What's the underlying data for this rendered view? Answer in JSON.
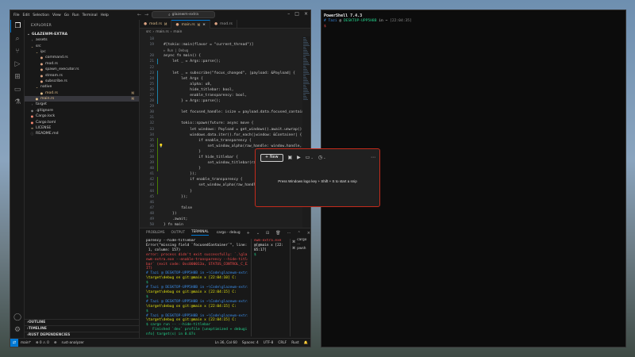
{
  "vscode": {
    "menu": [
      "File",
      "Edit",
      "Selection",
      "View",
      "Go",
      "Run",
      "Terminal",
      "Help"
    ],
    "search": "glazewm-extra",
    "explorer_header": "EXPLORER",
    "project_root": "GLAZEWM-EXTRA",
    "tree": [
      {
        "label": "assets",
        "indent": 1,
        "icon": "›",
        "color": "c-gray",
        "badge": ""
      },
      {
        "label": "src",
        "indent": 1,
        "icon": "⌄",
        "color": "c-yellow",
        "badge": ""
      },
      {
        "label": "ipc",
        "indent": 2,
        "icon": "⌄",
        "color": "c-yellow",
        "badge": ""
      },
      {
        "label": "command.rs",
        "indent": 3,
        "icon": "●",
        "color": "c-rust",
        "badge": ""
      },
      {
        "label": "mod.rs",
        "indent": 3,
        "icon": "●",
        "color": "c-rust",
        "badge": ""
      },
      {
        "label": "spawn_executor.rs",
        "indent": 3,
        "icon": "●",
        "color": "c-rust",
        "badge": ""
      },
      {
        "label": "stream.rs",
        "indent": 3,
        "icon": "●",
        "color": "c-rust",
        "badge": ""
      },
      {
        "label": "subscribe.rs",
        "indent": 3,
        "icon": "●",
        "color": "c-rust",
        "badge": ""
      },
      {
        "label": "native",
        "indent": 2,
        "icon": "⌄",
        "color": "c-yellow",
        "badge": ""
      },
      {
        "label": "mod.rs",
        "indent": 3,
        "icon": "●",
        "color": "c-yellow",
        "badge": "M"
      },
      {
        "label": "main.rs",
        "indent": 2,
        "icon": "●",
        "color": "c-yellow",
        "badge": "M",
        "selected": true
      },
      {
        "label": "target",
        "indent": 1,
        "icon": "›",
        "color": "c-gray",
        "badge": ""
      },
      {
        "label": ".gitignore",
        "indent": 1,
        "icon": "◆",
        "color": "c-gray",
        "badge": ""
      },
      {
        "label": "Cargo.lock",
        "indent": 1,
        "icon": "●",
        "color": "c-red",
        "badge": ""
      },
      {
        "label": "Cargo.toml",
        "indent": 1,
        "icon": "●",
        "color": "c-red",
        "badge": ""
      },
      {
        "label": "LICENSE",
        "indent": 1,
        "icon": "≡",
        "color": "c-yellow",
        "badge": ""
      },
      {
        "label": "README.md",
        "indent": 1,
        "icon": "ⓘ",
        "color": "c-gray",
        "badge": ""
      }
    ],
    "sections": [
      "OUTLINE",
      "TIMELINE",
      "RUST DEPENDENCIES"
    ],
    "tabs": [
      {
        "label": "mod.rs",
        "mod": "M",
        "active": false
      },
      {
        "label": "main.rs",
        "mod": "M",
        "active": true
      },
      {
        "label": "mod.rs",
        "mod": "",
        "active": false
      }
    ],
    "breadcrumb": [
      "src",
      "main.rs",
      "main"
    ],
    "code": [
      {
        "n": "18",
        "t": "",
        "g": "none"
      },
      {
        "n": "19",
        "t": "#[tokio::main(flavor = \"current_thread\")]",
        "g": "none"
      },
      {
        "n": "",
        "t": "▷ Run | Debug",
        "g": "none",
        "lens": true
      },
      {
        "n": "20",
        "t": "async fn main() {",
        "g": "none"
      },
      {
        "n": "21",
        "t": "    let _ = Args::parse();",
        "g": "mod"
      },
      {
        "n": "22",
        "t": "",
        "g": "none"
      },
      {
        "n": "23",
        "t": "    let _ = subscribe(\"focus_changed\", |payload: &Payload| {",
        "g": "mod"
      },
      {
        "n": "24",
        "t": "        let Args {",
        "g": "mod"
      },
      {
        "n": "25",
        "t": "            alpha: u8,",
        "g": "mod"
      },
      {
        "n": "26",
        "t": "            hide_titlebar: bool,",
        "g": "mod"
      },
      {
        "n": "27",
        "t": "            enable_transparency: bool,",
        "g": "mod"
      },
      {
        "n": "28",
        "t": "        } = Args::parse();",
        "g": "mod"
      },
      {
        "n": "29",
        "t": "",
        "g": "none"
      },
      {
        "n": "30",
        "t": "        let focused_handle: isize = payload.data.focused_container.h",
        "g": "none"
      },
      {
        "n": "31",
        "t": "",
        "g": "none"
      },
      {
        "n": "32",
        "t": "        tokio::spawn(future: async move {",
        "g": "none"
      },
      {
        "n": "33",
        "t": "            let windows: Payload = get_windows().await.unwrap();",
        "g": "none"
      },
      {
        "n": "34",
        "t": "            windows.data.iter().for_each(|window: &Container| {",
        "g": "none"
      },
      {
        "n": "35",
        "t": "                if enable_transparency {",
        "g": "add"
      },
      {
        "n": "36",
        "t": "                    set_window_alpha(raw_handle: window.handle, alpha",
        "g": "add",
        "bulb": true
      },
      {
        "n": "37",
        "t": "                }",
        "g": "add"
      },
      {
        "n": "38",
        "t": "                if hide_titlebar {",
        "g": "add"
      },
      {
        "n": "39",
        "t": "                    set_window_titlebar(raw_handl",
        "g": "add"
      },
      {
        "n": "40",
        "t": "                }",
        "g": "add"
      },
      {
        "n": "41",
        "t": "            });",
        "g": "none"
      },
      {
        "n": "42",
        "t": "            if enable_transparency {",
        "g": "add"
      },
      {
        "n": "43",
        "t": "                set_window_alpha(raw_handle: focus",
        "g": "add"
      },
      {
        "n": "44",
        "t": "            }",
        "g": "add"
      },
      {
        "n": "45",
        "t": "        });",
        "g": "none"
      },
      {
        "n": "46",
        "t": "",
        "g": "none"
      },
      {
        "n": "47",
        "t": "        false",
        "g": "none"
      },
      {
        "n": "48",
        "t": "    })",
        "g": "none"
      },
      {
        "n": "49",
        "t": "    .await;",
        "g": "none"
      },
      {
        "n": "50",
        "t": "} fn main",
        "g": "none"
      }
    ],
    "panel_tabs": [
      "PROBLEMS",
      "OUTPUT",
      "TERMINAL"
    ],
    "panel_active_tab": "TERMINAL",
    "terminal_name": "cargo - debug",
    "terminal_lines": [
      {
        "c": "t-white",
        "t": "parency --hide-titlebar`"
      },
      {
        "c": "t-white",
        "t": "Error(\"missing field `focusedContainer`\", line:"
      },
      {
        "c": "t-white",
        "t": " 1, column: 157)"
      },
      {
        "c": "t-red",
        "t": "error: process didn't exit successfully: `.\\glaz"
      },
      {
        "c": "t-red",
        "t": "ewm-extra.exe --enable-transparency --hide-title"
      },
      {
        "c": "t-red",
        "t": "bar` (exit code: 0xc000013a, STATUS_CONTROL_C_EX"
      },
      {
        "c": "t-red",
        "t": "IT)"
      },
      {
        "c": "t-blue",
        "t": "# Tazi @ DESKTOP-UPP5H8B in ~\\Code\\glazewm-extra"
      },
      {
        "c": "t-yellow",
        "t": "\\target\\debug on git:@main x [22:04:10] C:"
      },
      {
        "c": "t-green",
        "t": "$"
      },
      {
        "c": "t-blue",
        "t": "# Tazi @ DESKTOP-UPP5H8B in ~\\Code\\glazewm-extra"
      },
      {
        "c": "t-yellow",
        "t": "\\target\\debug on git:@main x [22:04:15] C:"
      },
      {
        "c": "t-green",
        "t": "$"
      },
      {
        "c": "t-blue",
        "t": "# Tazi @ DESKTOP-UPP5H8B in ~\\Code\\glazewm-extra"
      },
      {
        "c": "t-yellow",
        "t": "\\target\\debug on git:@main x [22:04:15] C:"
      },
      {
        "c": "t-green",
        "t": "$"
      },
      {
        "c": "t-blue",
        "t": "# Tazi @ DESKTOP-UPP5H8B in ~\\Code\\glazewm-extra"
      },
      {
        "c": "t-yellow",
        "t": "\\target\\debug on git:@main x [22:04:15] C:"
      },
      {
        "c": "t-green",
        "t": "$ cargo run -- --hide-titlebar"
      },
      {
        "c": "t-green",
        "t": "   Finished `dev` profile [unoptimized + debugi"
      },
      {
        "c": "t-green",
        "t": "nfo] target(s) in 0.07s"
      },
      {
        "c": "t-green",
        "t": "    Running `.\\glazewm-extra.exe --hide-titleba"
      },
      {
        "c": "t-white",
        "t": "r`"
      },
      {
        "c": "t-white",
        "t": "Error(\"missing field `focusedContainer`\", line:"
      },
      {
        "c": "t-white",
        "t": " 1, column: 157)"
      },
      {
        "c": "t-white",
        "t": "▯"
      }
    ],
    "split_lines": [
      {
        "c": "t-red",
        "t": "ewm-extra.exe"
      },
      {
        "c": "t-white",
        "t": "@[@main x [22:"
      },
      {
        "c": "t-white",
        "t": "05:17]"
      },
      {
        "c": "t-green",
        "t": "$"
      }
    ],
    "term_list": [
      "cargo ...",
      "pwsh"
    ],
    "status_left": [
      "main*",
      "⊗ 0 ⚠ 0",
      "⊕",
      "rust-analyzer"
    ],
    "status_right": [
      "Ln 36, Col 60",
      "Spaces: 4",
      "UTF-8",
      "CRLF",
      "Rust",
      "🔔"
    ]
  },
  "pwsh": {
    "title": "PowerShell 7.4.3",
    "prompt_user": "Tazi",
    "prompt_at": "@",
    "prompt_host": "DESKTOP-UPP5H8B",
    "prompt_in": "in ~",
    "prompt_time": "[22:04:35]",
    "prompt_symbol": "$"
  },
  "snip": {
    "new_label": "New",
    "message": "Press Windows logo key + Shift + S to start a snip"
  }
}
